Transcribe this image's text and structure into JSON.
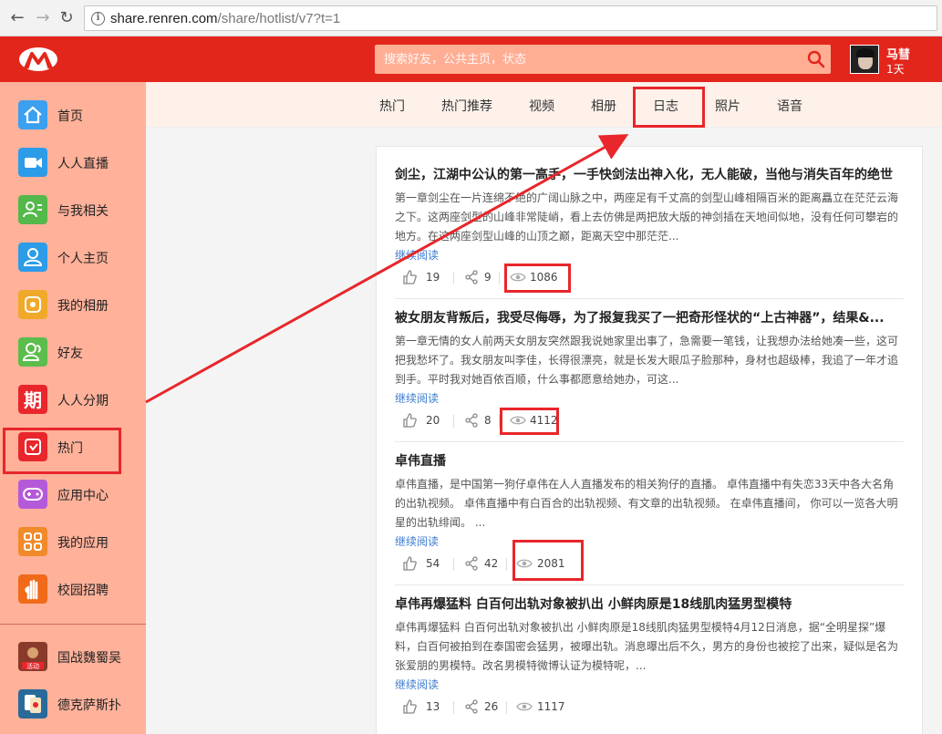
{
  "browser": {
    "url_host": "share.renren.com",
    "url_path": "/share/hotlist/v7?t=1"
  },
  "header": {
    "search_placeholder": "搜索好友，公共主页，状态",
    "user_name": "马彗",
    "user_days": "1天"
  },
  "sidebar": {
    "items": [
      {
        "label": "首页",
        "icon": "home-icon",
        "color": "#3aa0ef"
      },
      {
        "label": "人人直播",
        "icon": "video-camera-icon",
        "color": "#2d9ce8"
      },
      {
        "label": "与我相关",
        "icon": "user-list-icon",
        "color": "#55b84a"
      },
      {
        "label": "个人主页",
        "icon": "person-icon",
        "color": "#2d9ce8"
      },
      {
        "label": "我的相册",
        "icon": "album-icon",
        "color": "#f0a92a"
      },
      {
        "label": "好友",
        "icon": "friends-icon",
        "color": "#5cbc4c"
      },
      {
        "label": "人人分期",
        "icon": "installment-icon",
        "color": "#e8262b"
      },
      {
        "label": "热门",
        "icon": "hot-icon",
        "color": "#e8262b"
      },
      {
        "label": "应用中心",
        "icon": "gamepad-icon",
        "color": "#b45ad8"
      },
      {
        "label": "我的应用",
        "icon": "apps-grid-icon",
        "color": "#f08a2a"
      },
      {
        "label": "校园招聘",
        "icon": "hand-icon",
        "color": "#f06a1a"
      },
      {
        "label": "国战魏蜀吴",
        "icon": "game-thumb-icon",
        "color": "#8a3a2a"
      },
      {
        "label": "德克萨斯扑",
        "icon": "poker-thumb-icon",
        "color": "#2a6a9a"
      }
    ],
    "game_badge": "活动"
  },
  "tabs": [
    "热门",
    "热门推荐",
    "视频",
    "相册",
    "日志",
    "照片",
    "语音"
  ],
  "posts": [
    {
      "title": "剑尘，江湖中公认的第一高手，一手快剑法出神入化，无人能破，当他与消失百年的绝世",
      "body": "第一章剑尘在一片连绵不绝的广阔山脉之中，两座足有千丈高的剑型山峰相隔百米的距离矗立在茫茫云海之下。这两座剑型的山峰非常陡峭，看上去仿佛是两把放大版的神剑插在天地间似地，没有任何可攀岩的地方。在这两座剑型山峰的山顶之巅，距离天空中那茫茫...",
      "more": "继续阅读",
      "likes": "19",
      "shares": "9",
      "views": "1086"
    },
    {
      "title": "被女朋友背叛后，我受尽侮辱，为了报复我买了一把奇形怪状的“上古神器”，结果&...",
      "body": "第一章无情的女人前两天女朋友突然跟我说她家里出事了，急需要一笔钱，让我想办法给她凑一些，这可把我愁坏了。我女朋友叫李佳，长得很漂亮，就是长发大眼瓜子脸那种，身材也超级棒，我追了一年才追到手。平时我对她百依百顺，什么事都愿意给她办，可这...",
      "more": "继续阅读",
      "likes": "20",
      "shares": "8",
      "views": "4112"
    },
    {
      "title": "卓伟直播",
      "body": "卓伟直播，是中国第一狗仔卓伟在人人直播发布的相关狗仔的直播。 卓伟直播中有失恋33天中各大名角的出轨视频。 卓伟直播中有白百合的出轨视频、有文章的出轨视频。 在卓伟直播间， 你可以一览各大明星的出轨绯闻。 ...",
      "more": "继续阅读",
      "likes": "54",
      "shares": "42",
      "views": "2081"
    },
    {
      "title": "卓伟再爆猛料 白百何出轨对象被扒出 小鲜肉原是18线肌肉猛男型模特",
      "body": "卓伟再爆猛料 白百何出轨对象被扒出 小鲜肉原是18线肌肉猛男型模特4月12日消息，据“全明星探”爆料，白百何被拍到在泰国密会猛男，被曝出轨。消息曝出后不久，男方的身份也被挖了出来，疑似是名为张爱朋的男模特。改名男模特微博认证为模特呢，...",
      "more": "继续阅读",
      "likes": "13",
      "shares": "26",
      "views": "1117"
    }
  ],
  "colors": {
    "brand_red": "#e3261c",
    "sidebar_bg": "#ffb19a",
    "annotation_red": "#e8262b",
    "link_blue": "#3b7bd0"
  }
}
